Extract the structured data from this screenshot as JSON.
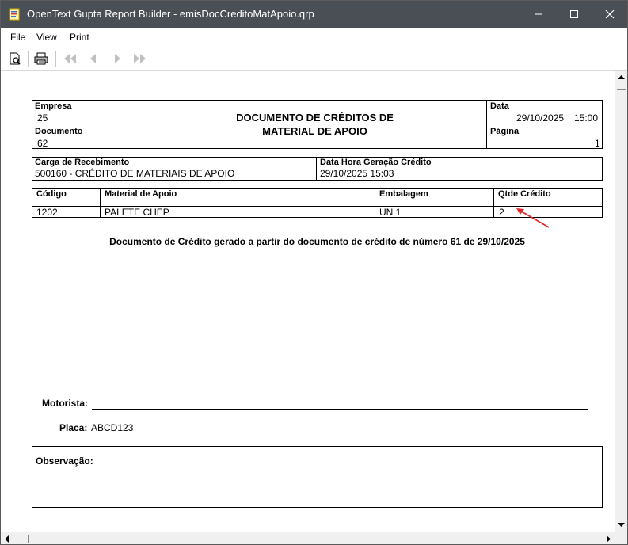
{
  "window": {
    "title": "OpenText Gupta Report Builder - emisDocCreditoMatApoio.qrp"
  },
  "menu": [
    "File",
    "View",
    "Print"
  ],
  "report": {
    "header": {
      "empresa_label": "Empresa",
      "empresa_value": "25",
      "documento_label": "Documento",
      "documento_value": "62",
      "title_line1": "DOCUMENTO DE CRÉDITOS DE",
      "title_line2": "MATERIAL DE APOIO",
      "data_label": "Data",
      "data_value": "29/10/2025",
      "hora_value": "15:00",
      "pagina_label": "Página",
      "pagina_value": "1"
    },
    "carga": {
      "carga_label": "Carga de Recebimento",
      "carga_value": "500160 - CRÉDITO DE MATERIAIS DE APOIO",
      "datahora_label": "Data Hora Geração Crédito",
      "datahora_value": "29/10/2025 15:03"
    },
    "table": {
      "columns": [
        "Código",
        "Material de Apoio",
        "Embalagem",
        "Qtde Crédito"
      ],
      "rows": [
        [
          "1202",
          "PALETE CHEP",
          "UN 1",
          "2"
        ]
      ]
    },
    "note": "Documento de Crédito gerado a partir do documento de crédito de número 61 de 29/10/2025",
    "motorista_label": "Motorista:",
    "placa_label": "Placa:",
    "placa_value": "ABCD123",
    "observacao_label": "Observação:"
  },
  "colors": {
    "titlebar": "#4a4f55",
    "arrow": "#e0262b"
  }
}
